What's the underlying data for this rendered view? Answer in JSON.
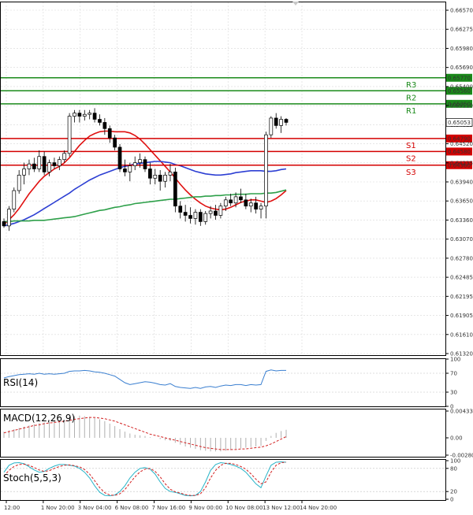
{
  "chart_data": [
    {
      "type": "candlestick",
      "pane": "price",
      "ylim": [
        0.6132,
        0.6686
      ],
      "y_ticks": [
        "0.66570",
        "0.66275",
        "0.65980",
        "0.65690",
        "0.65400",
        "0.65110",
        "0.64815",
        "0.64520",
        "0.64235",
        "0.63940",
        "0.63650",
        "0.63360",
        "0.63070",
        "0.62780",
        "0.62485",
        "0.62195",
        "0.61905",
        "0.61610",
        "0.61320"
      ],
      "x_ticks": [
        "12:00",
        "1 Nov 20:00",
        "3 Nov 04:00",
        "6 Nov 08:00",
        "7 Nov 16:00",
        "9 Nov 00:00",
        "10 Nov 08:00",
        "13 Nov 12:00",
        "14 Nov 20:00"
      ],
      "current_price": "0.65053",
      "levels": [
        {
          "name": "R3",
          "value": 0.6577,
          "label": "0.65770",
          "color": "#1a8a1a"
        },
        {
          "name": "R2",
          "value": 0.6556,
          "label": "0.65560",
          "color": "#1a8a1a"
        },
        {
          "name": "R1",
          "value": 0.6535,
          "label": "0.65350",
          "color": "#1a8a1a"
        },
        {
          "name": "S1",
          "value": 0.6479,
          "label": "0.64790",
          "color": "#d40000"
        },
        {
          "name": "S2",
          "value": 0.6458,
          "label": "0.64580",
          "color": "#d40000"
        },
        {
          "name": "S3",
          "value": 0.6436,
          "label": "0.64360",
          "color": "#d40000"
        }
      ],
      "candles": [
        [
          0.6345,
          0.635,
          0.6335,
          0.6338
        ],
        [
          0.6338,
          0.637,
          0.633,
          0.6365
        ],
        [
          0.6365,
          0.64,
          0.636,
          0.6395
        ],
        [
          0.6395,
          0.6428,
          0.639,
          0.642
        ],
        [
          0.642,
          0.644,
          0.6405,
          0.643
        ],
        [
          0.643,
          0.6445,
          0.642,
          0.6438
        ],
        [
          0.6438,
          0.6448,
          0.6425,
          0.643
        ],
        [
          0.643,
          0.646,
          0.6425,
          0.645
        ],
        [
          0.645,
          0.6458,
          0.642,
          0.6425
        ],
        [
          0.6425,
          0.6445,
          0.6418,
          0.644
        ],
        [
          0.644,
          0.6448,
          0.643,
          0.6435
        ],
        [
          0.6435,
          0.645,
          0.6428,
          0.6445
        ],
        [
          0.6445,
          0.646,
          0.644,
          0.6455
        ],
        [
          0.6455,
          0.652,
          0.645,
          0.6515
        ],
        [
          0.6515,
          0.6525,
          0.6505,
          0.652
        ],
        [
          0.652,
          0.6525,
          0.6505,
          0.6515
        ],
        [
          0.6515,
          0.6525,
          0.6508,
          0.6518
        ],
        [
          0.6518,
          0.6525,
          0.651,
          0.652
        ],
        [
          0.652,
          0.6528,
          0.6505,
          0.651
        ],
        [
          0.651,
          0.6518,
          0.65,
          0.6505
        ],
        [
          0.6505,
          0.6512,
          0.6485,
          0.6495
        ],
        [
          0.6495,
          0.65,
          0.6472,
          0.648
        ],
        [
          0.648,
          0.6485,
          0.646,
          0.6465
        ],
        [
          0.6465,
          0.647,
          0.6425,
          0.643
        ],
        [
          0.643,
          0.6445,
          0.6418,
          0.6425
        ],
        [
          0.6425,
          0.644,
          0.641,
          0.6435
        ],
        [
          0.6435,
          0.645,
          0.6428,
          0.644
        ],
        [
          0.644,
          0.6455,
          0.6432,
          0.6445
        ],
        [
          0.6445,
          0.645,
          0.6425,
          0.643
        ],
        [
          0.643,
          0.644,
          0.6405,
          0.6415
        ],
        [
          0.6415,
          0.643,
          0.6405,
          0.642
        ],
        [
          0.642,
          0.6428,
          0.6395,
          0.641
        ],
        [
          0.641,
          0.6425,
          0.64,
          0.642
        ],
        [
          0.642,
          0.6438,
          0.641,
          0.6425
        ],
        [
          0.6425,
          0.6432,
          0.636,
          0.637
        ],
        [
          0.637,
          0.6378,
          0.635,
          0.636
        ],
        [
          0.636,
          0.6372,
          0.6345,
          0.6355
        ],
        [
          0.6355,
          0.6368,
          0.6342,
          0.635
        ],
        [
          0.635,
          0.6365,
          0.634,
          0.636
        ],
        [
          0.636,
          0.6365,
          0.6338,
          0.6345
        ],
        [
          0.6345,
          0.6362,
          0.634,
          0.6358
        ],
        [
          0.6358,
          0.637,
          0.635,
          0.6362
        ],
        [
          0.6362,
          0.6372,
          0.6348,
          0.6355
        ],
        [
          0.6355,
          0.6375,
          0.635,
          0.637
        ],
        [
          0.637,
          0.6385,
          0.6362,
          0.638
        ],
        [
          0.638,
          0.639,
          0.637,
          0.6375
        ],
        [
          0.6375,
          0.6392,
          0.6368,
          0.6385
        ],
        [
          0.6385,
          0.6398,
          0.6375,
          0.638
        ],
        [
          0.638,
          0.639,
          0.6365,
          0.637
        ],
        [
          0.637,
          0.6382,
          0.636,
          0.6375
        ],
        [
          0.6375,
          0.6385,
          0.6358,
          0.6365
        ],
        [
          0.6365,
          0.6375,
          0.635,
          0.637
        ],
        [
          0.637,
          0.649,
          0.635,
          0.6485
        ],
        [
          0.6485,
          0.6515,
          0.648,
          0.6512
        ],
        [
          0.6512,
          0.652,
          0.6495,
          0.65
        ],
        [
          0.65,
          0.6515,
          0.6488,
          0.651
        ],
        [
          0.651,
          0.6512,
          0.65,
          0.6505
        ]
      ],
      "series": [
        {
          "name": "",
          "color": "#e01010",
          "values": [
            0.634,
            0.6348,
            0.6356,
            0.6366,
            0.6378,
            0.639,
            0.64,
            0.641,
            0.6418,
            0.6424,
            0.643,
            0.6434,
            0.644,
            0.6448,
            0.6458,
            0.6468,
            0.6476,
            0.6483,
            0.6487,
            0.649,
            0.6491,
            0.6491,
            0.649,
            0.649,
            0.649,
            0.6488,
            0.6484,
            0.6478,
            0.647,
            0.6461,
            0.6452,
            0.6443,
            0.6434,
            0.6425,
            0.6415,
            0.6405,
            0.6396,
            0.6388,
            0.6381,
            0.6375,
            0.637,
            0.6367,
            0.6365,
            0.6364,
            0.6365,
            0.6368,
            0.6372,
            0.6376,
            0.6378,
            0.638,
            0.638,
            0.6378,
            0.6376,
            0.6378,
            0.6382,
            0.6388,
            0.6395
          ]
        },
        {
          "name": "",
          "color": "#2d3fd3",
          "values": [
            0.6338,
            0.634,
            0.6342,
            0.6345,
            0.6348,
            0.6352,
            0.6356,
            0.6361,
            0.6366,
            0.6371,
            0.6376,
            0.6381,
            0.6386,
            0.6391,
            0.6397,
            0.6402,
            0.6407,
            0.6412,
            0.6416,
            0.642,
            0.6423,
            0.6426,
            0.6429,
            0.6432,
            0.6434,
            0.6436,
            0.6438,
            0.6439,
            0.644,
            0.6441,
            0.6442,
            0.6442,
            0.6441,
            0.644,
            0.6437,
            0.6435,
            0.6432,
            0.6429,
            0.6426,
            0.6424,
            0.6422,
            0.6421,
            0.642,
            0.642,
            0.6421,
            0.6422,
            0.6424,
            0.6425,
            0.6426,
            0.6427,
            0.6427,
            0.6427,
            0.6426,
            0.6426,
            0.6427,
            0.6429,
            0.643
          ]
        },
        {
          "name": "",
          "color": "#2ea04a",
          "values": [
            0.6345,
            0.6345,
            0.6346,
            0.6346,
            0.6346,
            0.6346,
            0.6347,
            0.6347,
            0.6347,
            0.6348,
            0.6349,
            0.635,
            0.6351,
            0.6352,
            0.6353,
            0.6355,
            0.6357,
            0.6359,
            0.6361,
            0.6363,
            0.6364,
            0.6366,
            0.6368,
            0.6369,
            0.6371,
            0.6372,
            0.6374,
            0.6375,
            0.6376,
            0.6377,
            0.6378,
            0.6379,
            0.638,
            0.6381,
            0.6381,
            0.6382,
            0.6383,
            0.6384,
            0.6385,
            0.6385,
            0.6386,
            0.6386,
            0.6387,
            0.6387,
            0.6388,
            0.6388,
            0.6389,
            0.6389,
            0.6389,
            0.639,
            0.639,
            0.639,
            0.6391,
            0.6391,
            0.6392,
            0.6394,
            0.6396
          ]
        }
      ]
    },
    {
      "type": "line",
      "pane": "rsi",
      "label": "RSI(14)",
      "ylim": [
        0,
        100
      ],
      "y_ticks": [
        "100",
        "70",
        "30",
        "0"
      ],
      "series": [
        {
          "name": "",
          "color": "#3a7fd0",
          "values": [
            60,
            63,
            65,
            67,
            68,
            69,
            68,
            70,
            68,
            69,
            68,
            69,
            70,
            74,
            75,
            75,
            76,
            75,
            73,
            72,
            70,
            67,
            64,
            57,
            50,
            46,
            48,
            50,
            52,
            51,
            49,
            46,
            45,
            48,
            42,
            40,
            39,
            38,
            40,
            38,
            41,
            42,
            40,
            43,
            45,
            44,
            46,
            46,
            44,
            46,
            45,
            46,
            74,
            77,
            75,
            76,
            76
          ]
        }
      ]
    },
    {
      "type": "bar+line",
      "pane": "macd",
      "label": "MACD(12,26,9)",
      "ylim": [
        -0.002807,
        0.004335
      ],
      "y_ticks": [
        "0.004335",
        "0.00",
        "-0.002807"
      ],
      "histogram": [
        0.001,
        0.0012,
        0.0014,
        0.0016,
        0.0018,
        0.002,
        0.0022,
        0.0024,
        0.0025,
        0.0026,
        0.0027,
        0.0028,
        0.0029,
        0.0033,
        0.0035,
        0.0036,
        0.0035,
        0.0034,
        0.0032,
        0.003,
        0.0027,
        0.0023,
        0.0019,
        0.0014,
        0.001,
        0.0007,
        0.0005,
        0.0004,
        0.0003,
        0.0001,
        0.0,
        -0.0002,
        -0.0004,
        -0.0005,
        -0.0008,
        -0.0011,
        -0.0014,
        -0.0016,
        -0.0018,
        -0.002,
        -0.0021,
        -0.0022,
        -0.0022,
        -0.0022,
        -0.0021,
        -0.002,
        -0.0018,
        -0.0017,
        -0.0016,
        -0.0015,
        -0.0014,
        -0.0013,
        -0.0005,
        0.0003,
        0.0008,
        0.0011,
        0.0013
      ],
      "series": [
        {
          "name": "",
          "color": "#d21f1f",
          "values": [
            0.0008,
            0.001,
            0.0012,
            0.0014,
            0.0016,
            0.0018,
            0.002,
            0.0021,
            0.0023,
            0.0024,
            0.0025,
            0.0026,
            0.0027,
            0.0028,
            0.003,
            0.0031,
            0.0032,
            0.0033,
            0.0033,
            0.0032,
            0.0031,
            0.0029,
            0.0027,
            0.0024,
            0.0021,
            0.0018,
            0.0015,
            0.0012,
            0.0009,
            0.0006,
            0.0004,
            0.0002,
            0.0,
            -0.0002,
            -0.0004,
            -0.0006,
            -0.0008,
            -0.001,
            -0.0012,
            -0.0014,
            -0.0016,
            -0.0017,
            -0.0018,
            -0.0019,
            -0.0019,
            -0.0019,
            -0.0019,
            -0.0018,
            -0.0018,
            -0.0017,
            -0.0016,
            -0.0015,
            -0.0013,
            -0.001,
            -0.0006,
            -0.0002,
            0.0002
          ]
        }
      ]
    },
    {
      "type": "line",
      "pane": "stoch",
      "label": "Stoch(5,5,3)",
      "ylim": [
        0,
        100
      ],
      "y_ticks": [
        "100",
        "80",
        "20",
        "0"
      ],
      "series": [
        {
          "name": "",
          "color": "#28b4c8",
          "values": [
            70,
            88,
            94,
            95,
            92,
            84,
            76,
            70,
            72,
            80,
            86,
            90,
            90,
            88,
            86,
            80,
            70,
            55,
            35,
            18,
            10,
            9,
            11,
            20,
            35,
            55,
            70,
            80,
            82,
            78,
            65,
            45,
            28,
            20,
            18,
            14,
            10,
            9,
            10,
            20,
            45,
            75,
            90,
            95,
            93,
            90,
            86,
            80,
            70,
            55,
            40,
            30,
            60,
            88,
            96,
            97,
            96
          ]
        },
        {
          "name": "",
          "color": "#d21f1f",
          "values": [
            60,
            75,
            85,
            90,
            91,
            88,
            82,
            76,
            72,
            74,
            80,
            85,
            88,
            89,
            87,
            84,
            77,
            65,
            48,
            30,
            17,
            11,
            10,
            14,
            25,
            42,
            58,
            71,
            78,
            80,
            72,
            58,
            40,
            26,
            19,
            16,
            12,
            10,
            10,
            14,
            30,
            55,
            75,
            88,
            93,
            93,
            90,
            85,
            78,
            66,
            52,
            40,
            45,
            70,
            88,
            95,
            96
          ]
        }
      ]
    }
  ]
}
